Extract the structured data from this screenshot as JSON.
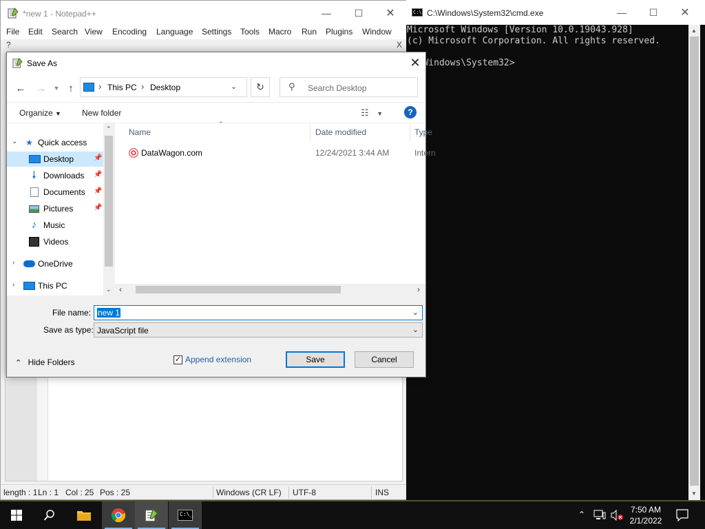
{
  "notepad": {
    "title": "*new 1 - Notepad++",
    "menu": [
      "File",
      "Edit",
      "Search",
      "View",
      "Encoding",
      "Language",
      "Settings",
      "Tools",
      "Macro",
      "Run",
      "Plugins",
      "Window"
    ],
    "menu_extra": "?",
    "menu_close": "X",
    "status": {
      "length": "length : 1",
      "ln": "Ln : 1",
      "col": "Col : 25",
      "pos": "Pos : 25",
      "eol": "Windows (CR LF)",
      "encoding": "UTF-8",
      "mode": "INS"
    }
  },
  "cmd": {
    "title": "C:\\Windows\\System32\\cmd.exe",
    "lines": [
      "Microsoft Windows [Version 10.0.19043.928]",
      "(c) Microsoft Corporation. All rights reserved.",
      "",
      "C:\\Windows\\System32>"
    ]
  },
  "dialog": {
    "title": "Save As",
    "address": {
      "crumbs": [
        "This PC",
        "Desktop"
      ]
    },
    "search_placeholder": "Search Desktop",
    "toolbar": {
      "organize": "Organize",
      "new_folder": "New folder"
    },
    "nav": {
      "quick_access": "Quick access",
      "items": [
        {
          "label": "Desktop",
          "icon": "desktop-icon",
          "pinned": true,
          "selected": true
        },
        {
          "label": "Downloads",
          "icon": "downloads-icon",
          "pinned": true
        },
        {
          "label": "Documents",
          "icon": "documents-icon",
          "pinned": true
        },
        {
          "label": "Pictures",
          "icon": "pictures-icon",
          "pinned": true
        },
        {
          "label": "Music",
          "icon": "music-icon"
        },
        {
          "label": "Videos",
          "icon": "videos-icon"
        }
      ],
      "onedrive": "OneDrive",
      "this_pc": "This PC"
    },
    "columns": {
      "name": "Name",
      "date_modified": "Date modified",
      "type": "Type"
    },
    "files": [
      {
        "name": "DataWagon.com",
        "date": "12/24/2021 3:44 AM",
        "type": "Intern"
      }
    ],
    "file_name_label": "File name:",
    "file_name_value": "new 1",
    "save_type_label": "Save as type:",
    "save_type_value": "JavaScript file",
    "hide_folders": "Hide Folders",
    "append_extension": "Append extension",
    "save_button": "Save",
    "cancel_button": "Cancel"
  },
  "taskbar": {
    "time": "7:50 AM",
    "date": "2/1/2022"
  }
}
